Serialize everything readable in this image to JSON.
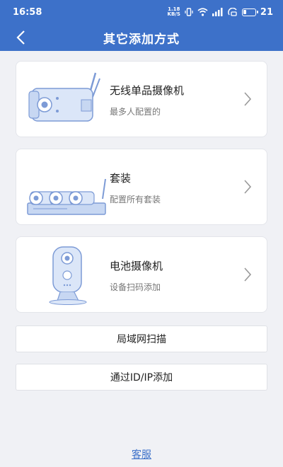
{
  "status_bar": {
    "time": "16:58",
    "net_speed_value": "1.18",
    "net_speed_unit": "KB/S",
    "battery_level": "21"
  },
  "nav": {
    "title": "其它添加方式",
    "back_icon": "chevron-left-icon"
  },
  "options": [
    {
      "title": "无线单品摄像机",
      "subtitle": "最多人配置的",
      "icon": "wireless-bullet-camera"
    },
    {
      "title": "套装",
      "subtitle": "配置所有套装",
      "icon": "camera-kit-nvr"
    },
    {
      "title": "电池摄像机",
      "subtitle": "设备扫码添加",
      "icon": "battery-camera"
    }
  ],
  "buttons": {
    "lan_scan": "局域网扫描",
    "add_by_id_ip": "通过ID/IP添加"
  },
  "footer": {
    "customer_service": "客服"
  },
  "colors": {
    "primary": "#3d71c9",
    "background": "#f0f1f5",
    "card": "#ffffff",
    "illustration_stroke": "#7d9bd6",
    "illustration_fill": "#dbe6f8"
  }
}
